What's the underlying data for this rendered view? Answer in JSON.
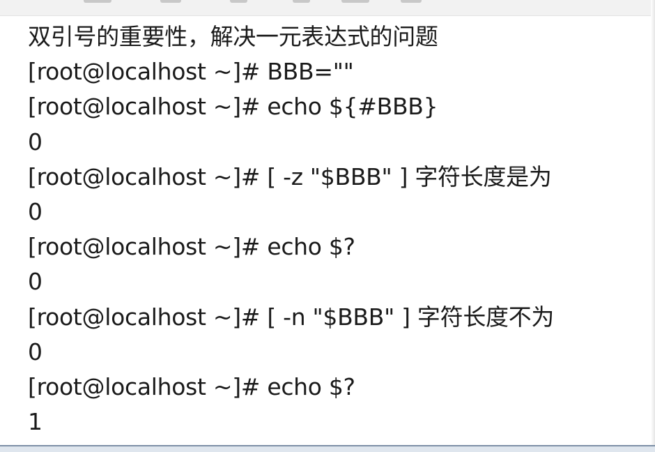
{
  "lines": [
    "双引号的重要性，解决一元表达式的问题",
    "[root@localhost ~]# BBB=\"\"",
    "[root@localhost ~]# echo ${#BBB}",
    "0",
    "[root@localhost ~]# [ -z \"$BBB\" ] 字符长度是为",
    "0",
    "[root@localhost ~]# echo $?",
    "0",
    "[root@localhost ~]# [ -n \"$BBB\" ] 字符长度不为",
    "0",
    "[root@localhost ~]# echo $?",
    "1"
  ]
}
